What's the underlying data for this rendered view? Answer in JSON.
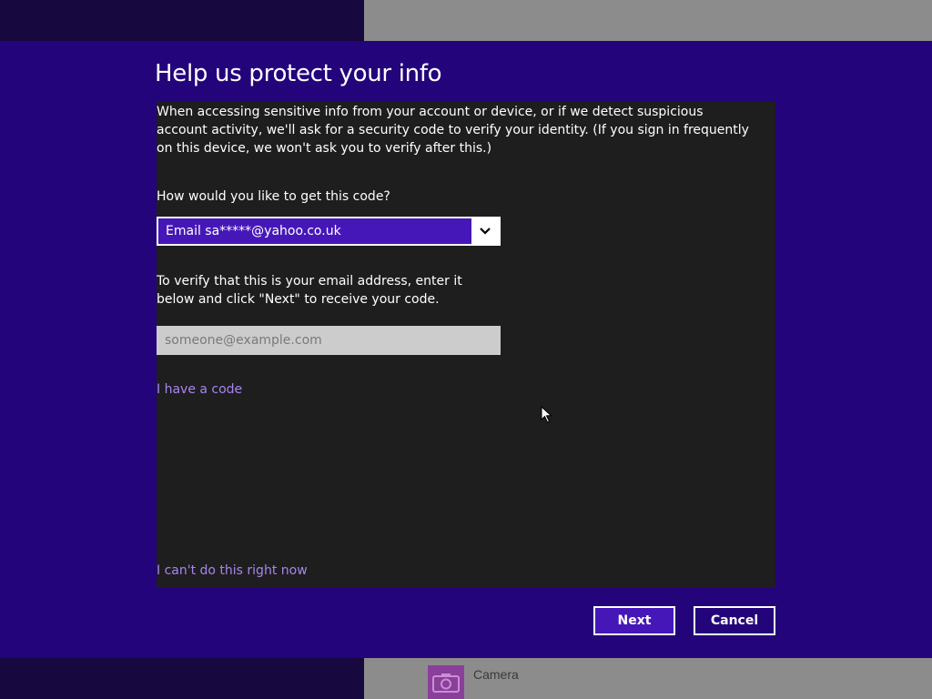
{
  "dialog": {
    "title": "Help us protect your info",
    "intro": "When accessing sensitive info from your account or device, or if we detect suspicious account activity, we'll ask for a security code to verify your identity. (If you sign in frequently on this device, we won't ask you to verify after this.)",
    "question": "How would you like to get this code?",
    "method_select": {
      "selected": "Email sa*****@yahoo.co.uk"
    },
    "verify_text": "To verify that this is your email address, enter it below and click \"Next\" to receive your code.",
    "email_field": {
      "value": "",
      "placeholder": "someone@example.com"
    },
    "have_code_link": "I have a code",
    "cant_do_link": "I can't do this right now",
    "buttons": {
      "next": "Next",
      "cancel": "Cancel"
    }
  },
  "background": {
    "tile_label": "Camera",
    "tile_icon": "camera-icon"
  },
  "colors": {
    "dialog_band": "#23047a",
    "accent": "#4617b8",
    "panel": "#1e1e1e",
    "link": "#a785f0"
  }
}
